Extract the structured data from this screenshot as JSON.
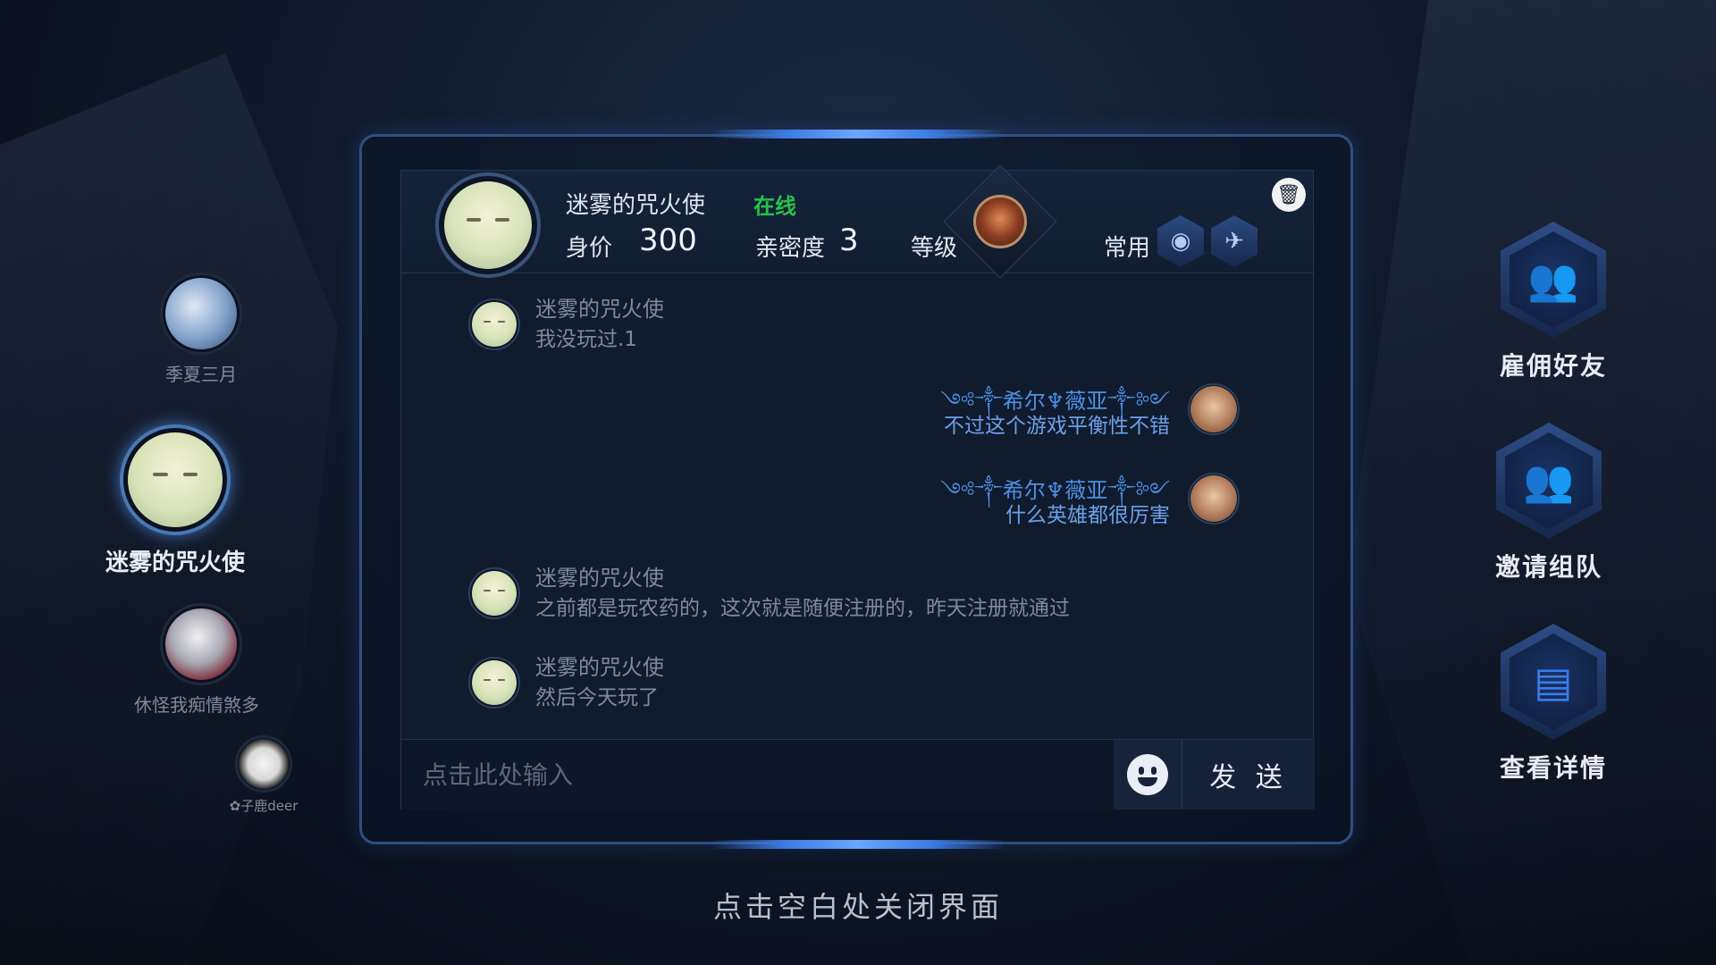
{
  "friends": [
    {
      "name": "季夏三月"
    },
    {
      "name": "迷雾的咒火使"
    },
    {
      "name": "休怪我痴情煞多"
    },
    {
      "name": "✿子鹿deer"
    }
  ],
  "header": {
    "name": "迷雾的咒火使",
    "status": "在线",
    "price_label": "身价",
    "price_value": "300",
    "intimacy_label": "亲密度",
    "intimacy_value": "3",
    "level_label": "等级",
    "common_label": "常用"
  },
  "messages": [
    {
      "sender": "迷雾的咒火使",
      "text": "我没玩过.1",
      "self": false
    },
    {
      "sender": "༺༒希尔♆薇亚༒༻",
      "text": "不过这个游戏平衡性不错",
      "self": true
    },
    {
      "sender": "༺༒希尔♆薇亚༒༻",
      "text": "什么英雄都很厉害",
      "self": true
    },
    {
      "sender": "迷雾的咒火使",
      "text": "之前都是玩农药的，这次就是随便注册的，昨天注册就通过",
      "self": false
    },
    {
      "sender": "迷雾的咒火使",
      "text": "然后今天玩了",
      "self": false
    }
  ],
  "input": {
    "placeholder": "点击此处输入",
    "send_label": "发 送"
  },
  "actions": [
    {
      "label": "雇佣好友",
      "icon": "hire-friend-icon"
    },
    {
      "label": "邀请组队",
      "icon": "invite-team-icon"
    },
    {
      "label": "查看详情",
      "icon": "details-document-icon"
    }
  ],
  "close_hint": "点击空白处关闭界面",
  "colors": {
    "online": "#27c24a",
    "self_message": "#6ba0e8",
    "accent_blue": "#3c7cf0"
  }
}
